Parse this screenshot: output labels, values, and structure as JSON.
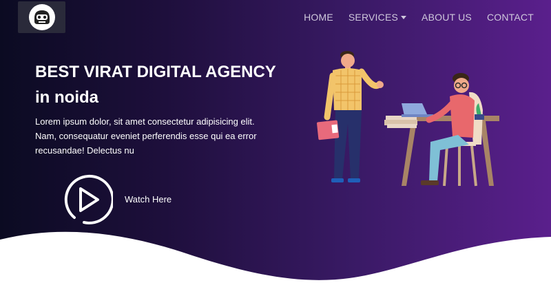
{
  "header": {
    "logo": {
      "icon": "helmet-logo-icon"
    },
    "nav": [
      {
        "label": "HOME"
      },
      {
        "label": "SERVICES",
        "has_dropdown": true
      },
      {
        "label": "ABOUT US"
      },
      {
        "label": "CONTACT"
      }
    ]
  },
  "hero": {
    "title_line1": "BEST VIRAT DIGITAL AGENCY",
    "title_line2": "in noida",
    "description": "Lorem ipsum dolor, sit amet consectetur adipisicing elit. Nam, consequatur eveniet perferendis esse qui ea error recusandae! Delectus nu",
    "watch": {
      "label": "Watch Here",
      "icon": "play-circle-icon"
    },
    "illustration": "office-people-illustration"
  },
  "colors": {
    "gradient_start": "#0b0b22",
    "gradient_end": "#5a1f8c",
    "nav_text": "#cfc8dc",
    "text": "#ffffff"
  }
}
